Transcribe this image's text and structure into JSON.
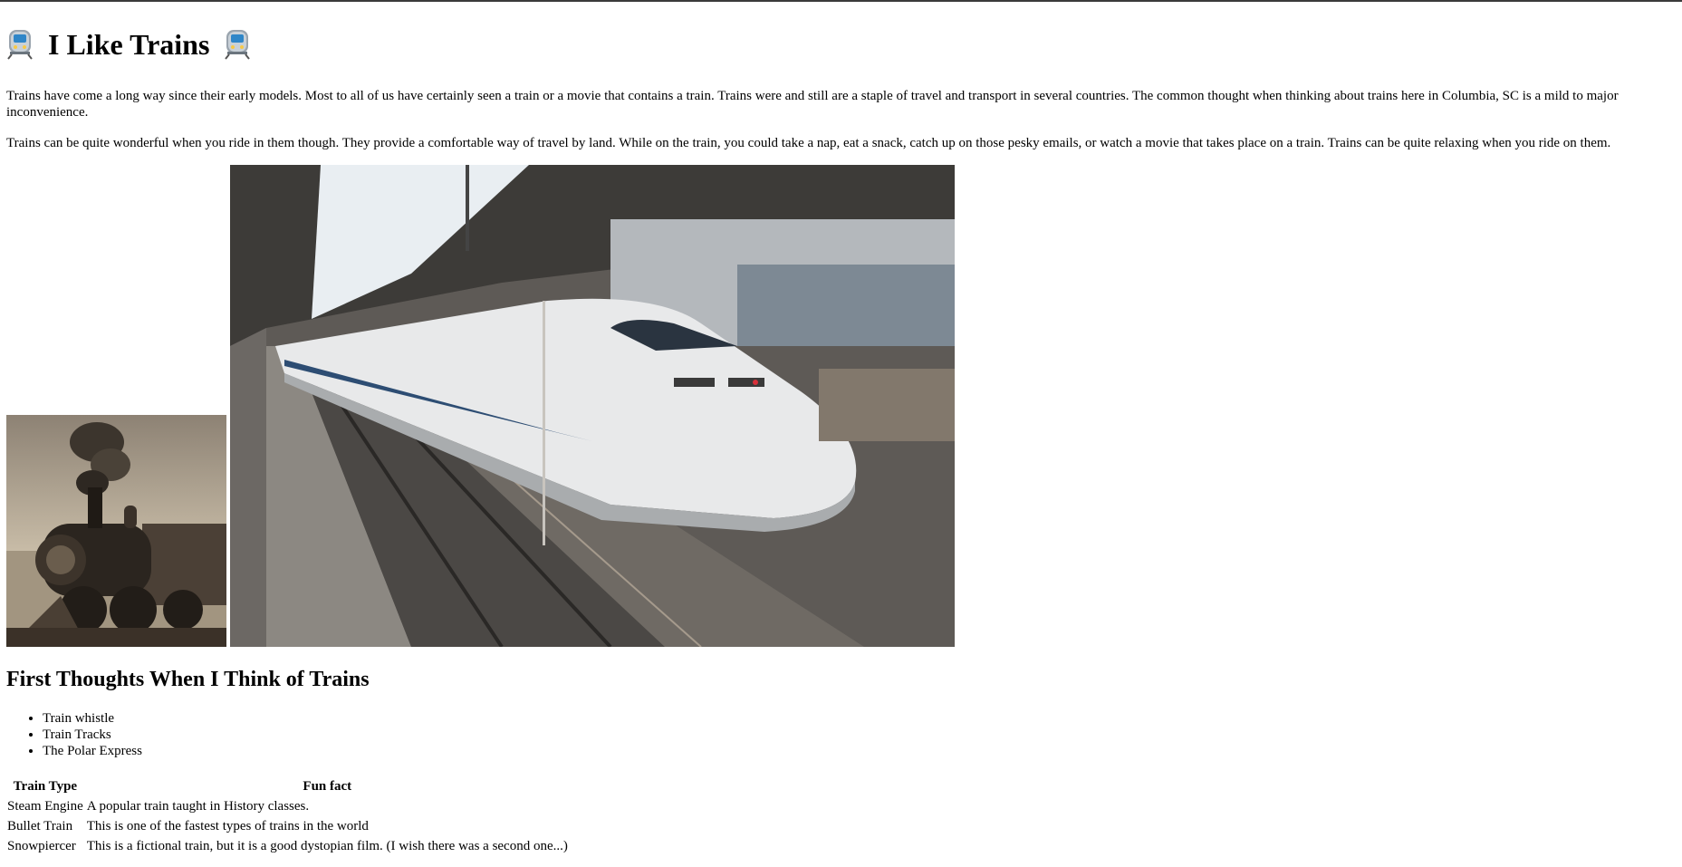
{
  "page": {
    "title": "I Like Trains",
    "title_icon": "train-front-icon"
  },
  "intro": {
    "paragraph1": "Trains have come a long way since their early models. Most to all of us have certainly seen a train or a movie that contains a train. Trains were and still are a staple of travel and transport in several countries. The common thought when thinking about trains here in Columbia, SC is a mild to major inconvenience.",
    "paragraph2": "Trains can be quite wonderful when you ride in them though. They provide a comfortable way of travel by land. While on the train, you could take a nap, eat a snack, catch up on those pesky emails, or watch a movie that takes place on a train. Trains can be quite relaxing when you ride on them."
  },
  "images": {
    "steam_train": "steam-locomotive-photo",
    "bullet_train": "bullet-train-photo"
  },
  "thoughts": {
    "heading": "First Thoughts When I Think of Trains",
    "items": [
      "Train whistle",
      "Train Tracks",
      "The Polar Express"
    ]
  },
  "table": {
    "headers": [
      "Train Type",
      "Fun fact"
    ],
    "rows": [
      [
        "Steam Engine",
        "A popular train taught in History classes."
      ],
      [
        "Bullet Train",
        "This is one of the fastest types of trains in the world"
      ],
      [
        "Snowpiercer",
        "This is a fictional train, but it is a good dystopian film. (I wish there was a second one...)"
      ]
    ]
  }
}
